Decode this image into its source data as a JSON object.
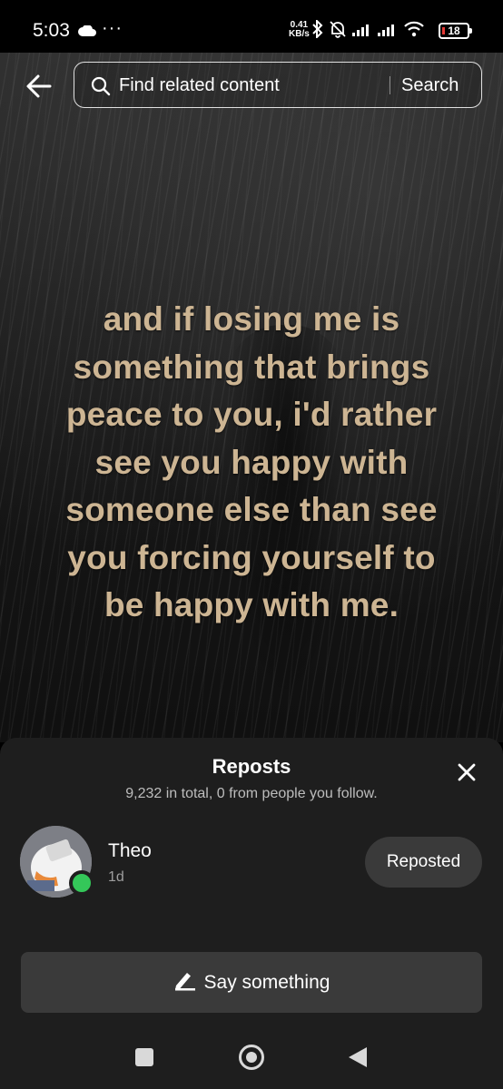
{
  "status_bar": {
    "time": "5:03",
    "dots": "···",
    "net_speed_value": "0.41",
    "net_speed_unit": "KB/s",
    "battery": "18",
    "icons": [
      "cloud-icon",
      "bluetooth-icon",
      "mute-bell-icon",
      "signal-icon",
      "signal-icon",
      "wifi-icon",
      "battery-icon"
    ]
  },
  "search": {
    "placeholder": "Find related content",
    "button_label": "Search"
  },
  "video": {
    "caption": "and if losing me is something that brings peace to you, i'd rather see you happy with someone else than see you forcing yourself to be happy with me.",
    "caption_color": "#cdb593"
  },
  "reposts_sheet": {
    "title": "Reposts",
    "subtitle": "9,232 in total, 0 from people you follow.",
    "items": [
      {
        "name": "Theo",
        "time": "1d",
        "button_label": "Reposted",
        "online": true
      }
    ],
    "say_label": "Say something"
  },
  "colors": {
    "sheet_bg": "#1e1e1e",
    "button_bg": "#3a3a3a",
    "online": "#34c759"
  }
}
